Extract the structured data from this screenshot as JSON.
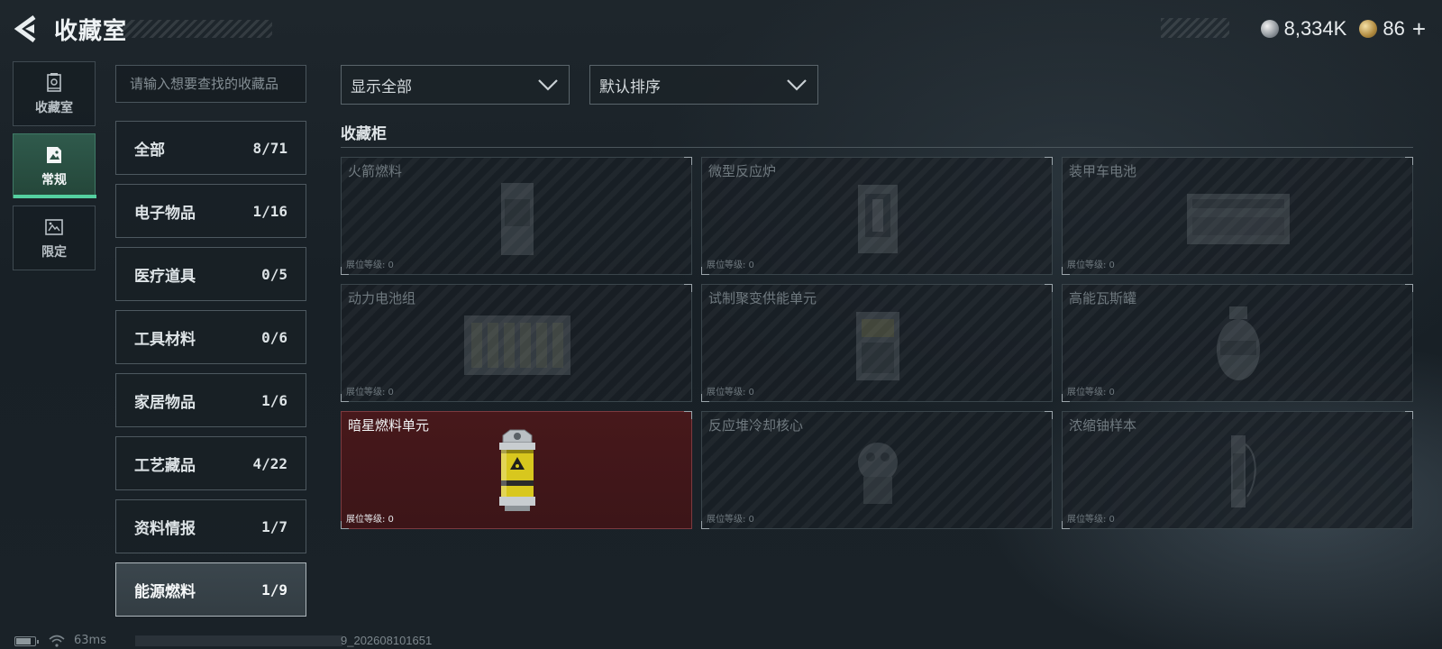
{
  "header": {
    "title": "收藏室",
    "currencies": [
      {
        "icon": "silver-coin-icon",
        "value": "8,334K"
      },
      {
        "icon": "gold-coin-icon",
        "value": "86"
      }
    ],
    "plus_label": "+"
  },
  "side_tabs": [
    {
      "label": "收藏室",
      "icon": "collection-room-icon",
      "active": false
    },
    {
      "label": "常规",
      "icon": "regular-icon",
      "active": true
    },
    {
      "label": "限定",
      "icon": "limited-icon",
      "active": false
    }
  ],
  "search": {
    "placeholder": "请输入想要查找的收藏品"
  },
  "categories": [
    {
      "name": "全部",
      "count": "8/71"
    },
    {
      "name": "电子物品",
      "count": "1/16"
    },
    {
      "name": "医疗道具",
      "count": "0/5"
    },
    {
      "name": "工具材料",
      "count": "0/6"
    },
    {
      "name": "家居物品",
      "count": "1/6"
    },
    {
      "name": "工艺藏品",
      "count": "4/22"
    },
    {
      "name": "资料情报",
      "count": "1/7"
    },
    {
      "name": "能源燃料",
      "count": "1/9"
    }
  ],
  "active_category": "能源燃料",
  "filters": {
    "show": "显示全部",
    "sort": "默认排序"
  },
  "cabinet": {
    "title": "收藏柜",
    "level_label": "展位等级: 0",
    "slots": [
      {
        "name": "火箭燃料",
        "owned": false
      },
      {
        "name": "微型反应炉",
        "owned": false
      },
      {
        "name": "装甲车电池",
        "owned": false
      },
      {
        "name": "动力电池组",
        "owned": false
      },
      {
        "name": "试制聚变供能单元",
        "owned": false
      },
      {
        "name": "高能瓦斯罐",
        "owned": false
      },
      {
        "name": "暗星燃料单元",
        "owned": true
      },
      {
        "name": "反应堆冷却核心",
        "owned": false
      },
      {
        "name": "浓缩铀样本",
        "owned": false
      }
    ]
  },
  "footer": {
    "ping": "63ms",
    "version": "9_202608101651"
  },
  "colors": {
    "accent_green": "#54d0a0",
    "owned_slot": "#47181b"
  }
}
